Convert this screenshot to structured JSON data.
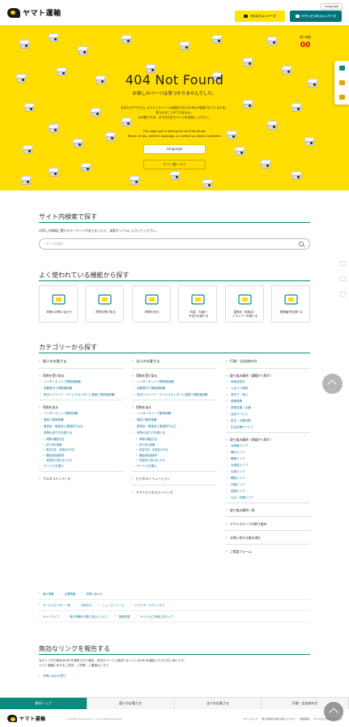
{
  "header": {
    "logo_text": "ヤマト運輸",
    "language_button": "Language",
    "kuroneko_button": "クロネコメンバーズ",
    "biz_button": "ヤマトビジネスメンバーズ"
  },
  "hero": {
    "counter_label": "残り時間",
    "counter_value": "00",
    "title": "404 Not Found",
    "subtitle": "お探しのページは見つかりませんでした。",
    "jp_message_1": "あなたがアクセスしようとしたページは削除されたかURLが変更されているため、",
    "jp_message_2": "見つけることができません。",
    "jp_message_3": "お手数ですが、以下の方法でページをお探しください。",
    "en_message_1": "The page you're looking for can't be found.",
    "en_message_2": "Return to top, select a language, or contact us about a problem.",
    "language_button": "Language",
    "retry_button": "もう一度トライ"
  },
  "site_search": {
    "title": "サイト内検索で探す",
    "description": "お探しの情報に関するキーワードがありましたら、検索ボックスに入力してください。",
    "placeholder": "サイト内検索"
  },
  "features": {
    "title": "よく使われている機能から探す",
    "items": [
      {
        "label": "荷物のお問い合わせ",
        "icon": "package-search-icon"
      },
      {
        "label": "荷物を受け取る",
        "icon": "home-icon"
      },
      {
        "label": "荷物を送る",
        "icon": "truck-icon"
      },
      {
        "label": "料金・お届け\n予定日を調べる",
        "icon": "calendar-yen-icon"
      },
      {
        "label": "直営店・取扱店・\nドライバーを調べる",
        "icon": "store-icon"
      },
      {
        "label": "郵便番号を調べる",
        "icon": "postal-icon"
      }
    ]
  },
  "categories": {
    "title": "カテゴリーから探す",
    "personal": {
      "head": "個人のお客さま",
      "receive_head": "荷物を受け取る",
      "receive_links": [
        "インターネットで再配達依頼",
        "自動受付で再配達依頼",
        "担当ドライバー・サービスセンターに直接で再配達依頼"
      ],
      "send_head": "荷物を送る",
      "send_links": [
        "インターネットで集荷依頼",
        "電話で集荷依頼",
        "直営店・取扱店に直接持ち込む",
        "荷物の送り方を調べる"
      ],
      "send_sub": [
        "荷物の梱包方法",
        "送り状の準備",
        "宛名方法・名宛名の方法",
        "梱包用包装資材",
        "宅急便で送れないもの"
      ],
      "send_last": "サービスを選ぶ",
      "member_head": "クロネコメンバーズ"
    },
    "corporate": {
      "head": "法人のお客さま",
      "receive_head": "荷物を受け取る",
      "receive_links": [
        "インターネットで再配達依頼",
        "自動受付で再配達依頼",
        "担当ドライバー・サービスセンターに直接で再配達依頼"
      ],
      "send_head": "荷物を送る",
      "send_links": [
        "インターネットで集荷依頼",
        "電話で集荷依頼",
        "直営店・取扱店に直接持ち込む",
        "荷物の送り方を調べる"
      ],
      "send_sub": [
        "荷物の梱包方法",
        "送り状の準備",
        "宛名方法・名宛名の方法",
        "梱包用包装資材",
        "宅急便で送れないもの"
      ],
      "send_last": "サービスを選ぶ",
      "biz_solution": "ビジネスソリューション",
      "biz_member": "ヤマトビジネスメンバーズ"
    },
    "government": {
      "head": "行政・自治体の方",
      "efforts_head": "取り組み事例（課題から探す）",
      "efforts_links": [
        "地域活性化",
        "ふるさと納税",
        "見守り・安心",
        "産業振興",
        "買物支援・交通",
        "住民サービス",
        "防災・災害対策",
        "生活支援サービス"
      ],
      "region_head": "取り組み事例（地域から探す）",
      "region_links": [
        "北海道エリア",
        "東北エリア",
        "関東エリア",
        "北信越エリア",
        "中部エリア",
        "関西エリア",
        "中国エリア",
        "四国エリア",
        "九州・沖縄エリア"
      ],
      "list_head": "取り組み事例一覧",
      "group": "ヤマトグループの取り組み",
      "flow": "お問い合わせ後の流れ",
      "form": "ご相談フォーム"
    }
  },
  "footer_links": {
    "row1": [
      "個人情報",
      "企業情報",
      "お問い合わせ"
    ],
    "row2": [
      "サービスセンター一覧",
      "お知らせ",
      "ニュースリリース",
      "ヤマトホールディングス"
    ],
    "row3": [
      "サイトマップ",
      "個人情報のお取り扱いについて",
      "免責事項",
      "サイトのご利用にあたって"
    ]
  },
  "report": {
    "title": "無効なリンクを報告する",
    "desc1": "当サイト内で無効なURLを発見された場合、該当のページと無効となっているURLを報告いただけると幸いです。",
    "desc2": "ヤマト運輸に対するご意見・ご質問・ご要望はこちら",
    "link": "お問い合わせ窓口"
  },
  "bottom_nav": [
    "総合トップ",
    "個人のお客さま",
    "法人のお客さま",
    "行政・自治体の方"
  ],
  "footer": {
    "logo_text": "ヤマト運輸",
    "copyright": "© Yamato Transport Co., Ltd. All Rights Reserved.",
    "links": [
      "サイトマップ",
      "個人情報のお取り扱いについて",
      "免責事項",
      "サイトのご利用にあたって"
    ]
  },
  "colors": {
    "brand_yellow": "#ffdd00",
    "brand_teal": "#0b8a7e",
    "biz_teal": "#00727a",
    "alert_red": "#e60012"
  }
}
